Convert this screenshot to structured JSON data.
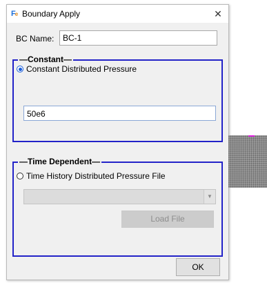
{
  "window": {
    "title": "Boundary Apply",
    "app_icon": "fe-app-icon",
    "close_glyph": "✕"
  },
  "bc_name": {
    "label": "BC Name:",
    "value": "BC-1"
  },
  "constant_group": {
    "title": "Constant",
    "radio_label": "Constant Distributed Pressure",
    "radio_checked": true,
    "value": "50e6"
  },
  "time_group": {
    "title": "Time Dependent",
    "radio_label": "Time History Distributed Pressure File",
    "radio_checked": false,
    "combo_value": "",
    "combo_arrow": "▼",
    "load_button": "Load File",
    "load_enabled": false
  },
  "footer": {
    "ok_label": "OK"
  },
  "colors": {
    "group_border": "#2222c8",
    "dialog_bg": "#f0f0f0",
    "radio_accent": "#1a5ed9",
    "marker": "#e020e0"
  }
}
